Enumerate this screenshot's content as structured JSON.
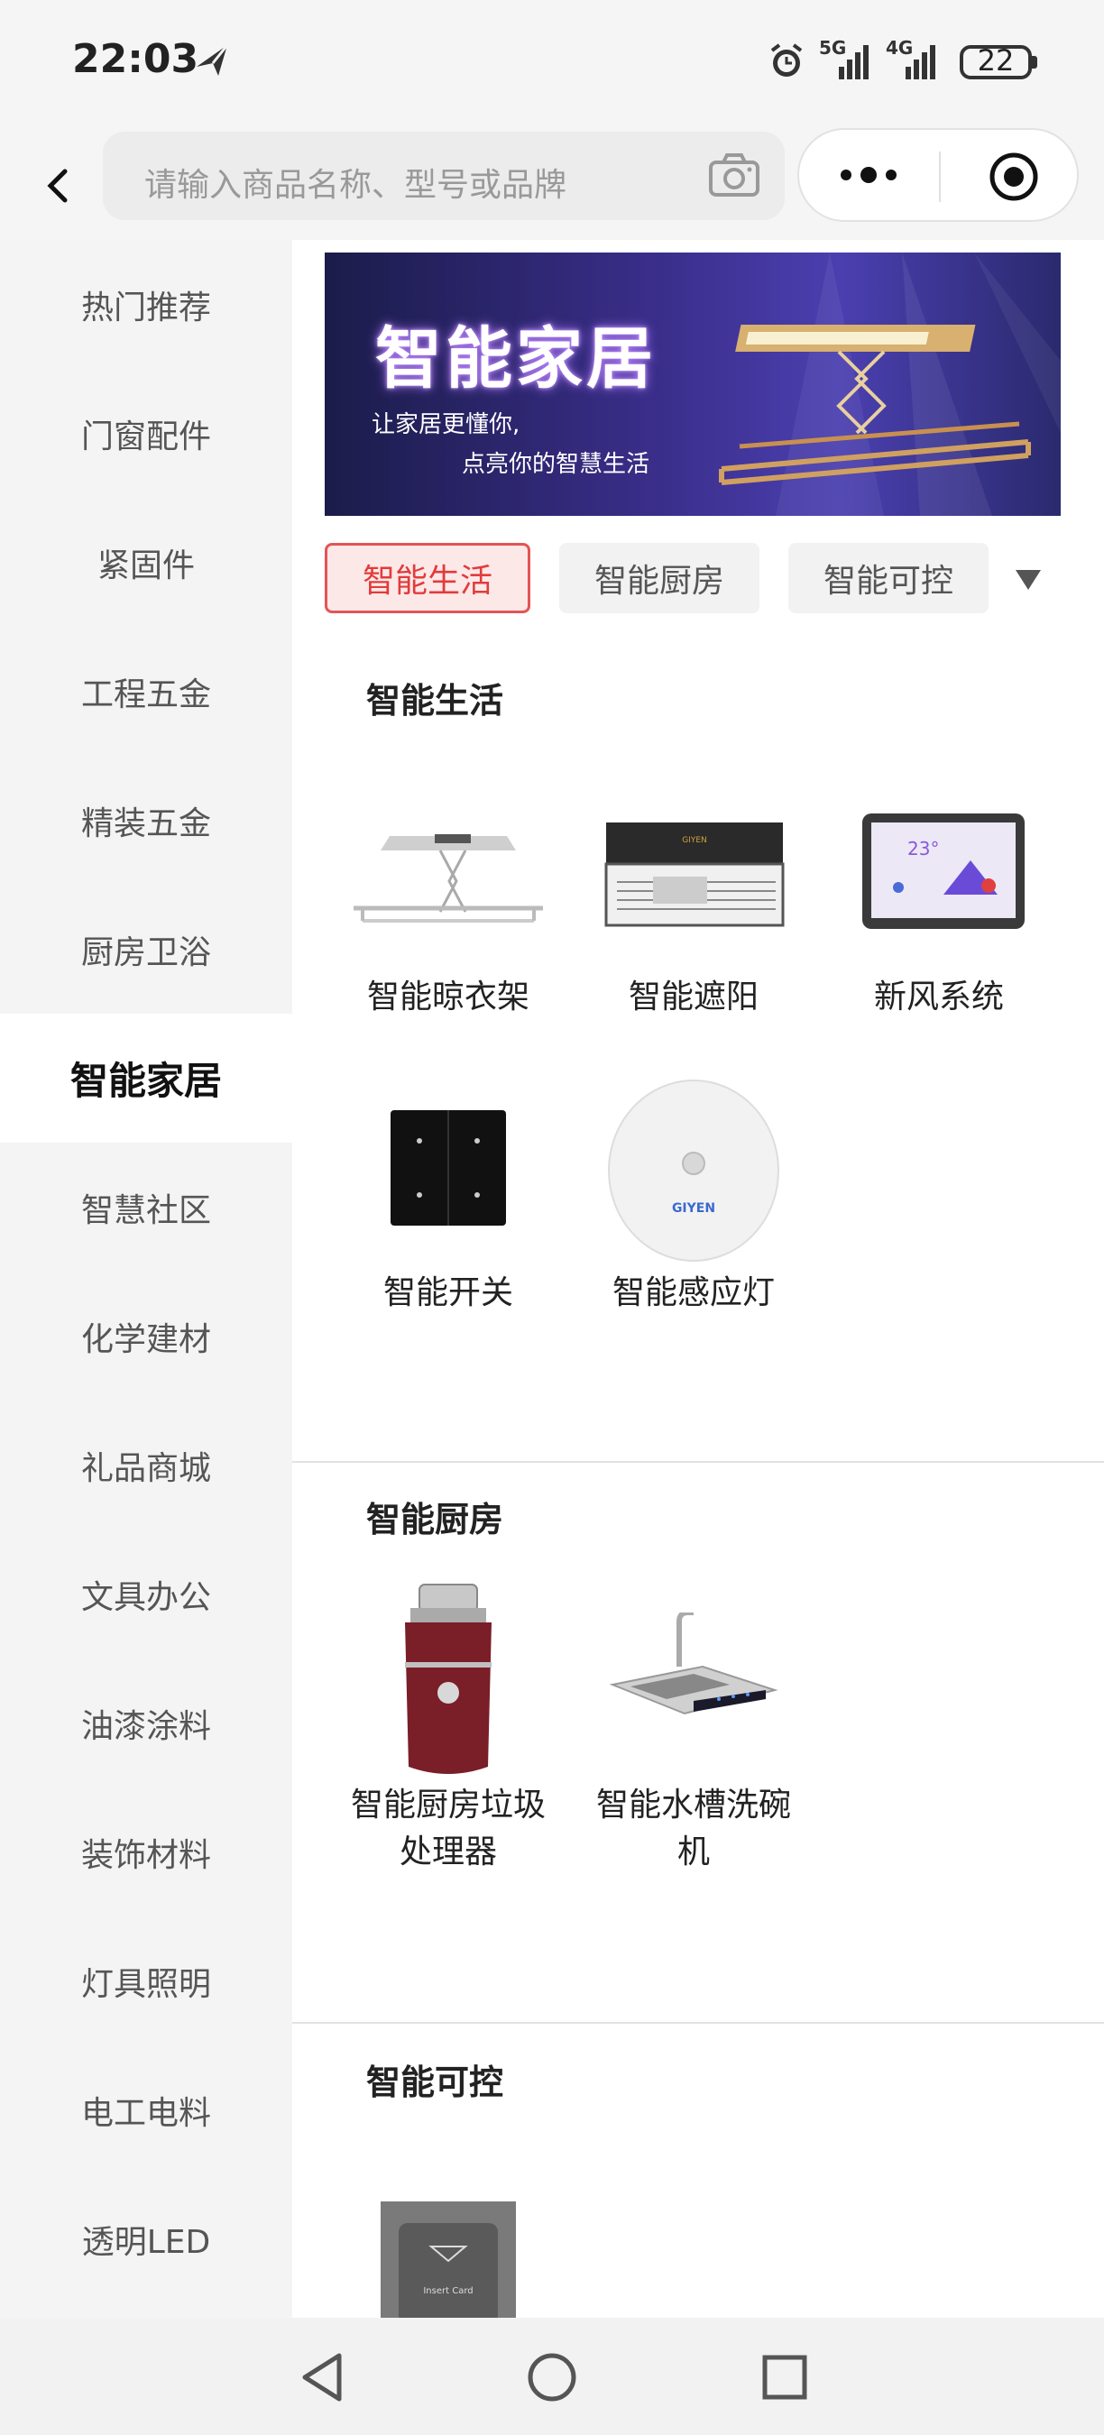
{
  "status_bar": {
    "time": "22:03",
    "signal_5g": "5G",
    "signal_4g": "4G",
    "battery": "22",
    "icons": [
      "send-icon",
      "alarm-icon",
      "signal-5g-icon",
      "signal-4g-icon",
      "battery-icon"
    ]
  },
  "header": {
    "search_placeholder": "请输入商品名称、型号或品牌",
    "icons": [
      "back-icon",
      "camera-icon",
      "more-icon",
      "target-icon"
    ]
  },
  "sidebar": {
    "items": [
      {
        "label": "热门推荐",
        "active": false
      },
      {
        "label": "门窗配件",
        "active": false
      },
      {
        "label": "紧固件",
        "active": false
      },
      {
        "label": "工程五金",
        "active": false
      },
      {
        "label": "精装五金",
        "active": false
      },
      {
        "label": "厨房卫浴",
        "active": false
      },
      {
        "label": "智能家居",
        "active": true
      },
      {
        "label": "智慧社区",
        "active": false
      },
      {
        "label": "化学建材",
        "active": false
      },
      {
        "label": "礼品商城",
        "active": false
      },
      {
        "label": "文具办公",
        "active": false
      },
      {
        "label": "油漆涂料",
        "active": false
      },
      {
        "label": "装饰材料",
        "active": false
      },
      {
        "label": "灯具照明",
        "active": false
      },
      {
        "label": "电工电料",
        "active": false
      },
      {
        "label": "透明LED",
        "active": false
      }
    ]
  },
  "banner": {
    "title": "智能家居",
    "subtitle_line1": "让家居更懂你,",
    "subtitle_line2": "点亮你的智慧生活"
  },
  "tabs": [
    {
      "label": "智能生活",
      "active": true
    },
    {
      "label": "智能厨房",
      "active": false
    },
    {
      "label": "智能可控",
      "active": false
    }
  ],
  "sections": [
    {
      "title": "智能生活",
      "products": [
        {
          "name": "智能晾衣架",
          "icon": "clothes-rack-image"
        },
        {
          "name": "智能遮阳",
          "icon": "sunshade-image"
        },
        {
          "name": "新风系统",
          "icon": "fresh-air-panel-image"
        },
        {
          "name": "智能开关",
          "icon": "smart-switch-image"
        },
        {
          "name": "智能感应灯",
          "icon": "sensor-light-image"
        }
      ]
    },
    {
      "title": "智能厨房",
      "products": [
        {
          "name": "智能厨房垃圾处理器",
          "icon": "garbage-disposer-image"
        },
        {
          "name": "智能水槽洗碗机",
          "icon": "sink-dishwasher-image"
        }
      ]
    },
    {
      "title": "智能可控",
      "products": [
        {
          "name": "",
          "icon": "card-switch-image"
        }
      ]
    }
  ],
  "product_texts": {
    "sensor_brand": "GIYEN",
    "card_text": "Insert Card"
  },
  "nav": {
    "icons": [
      "nav-back-icon",
      "nav-home-icon",
      "nav-recent-icon"
    ]
  },
  "colors": {
    "accent": "#e23b3b",
    "sidebar_bg": "#f4f4f4",
    "tab_bg": "#f2f2f2"
  }
}
